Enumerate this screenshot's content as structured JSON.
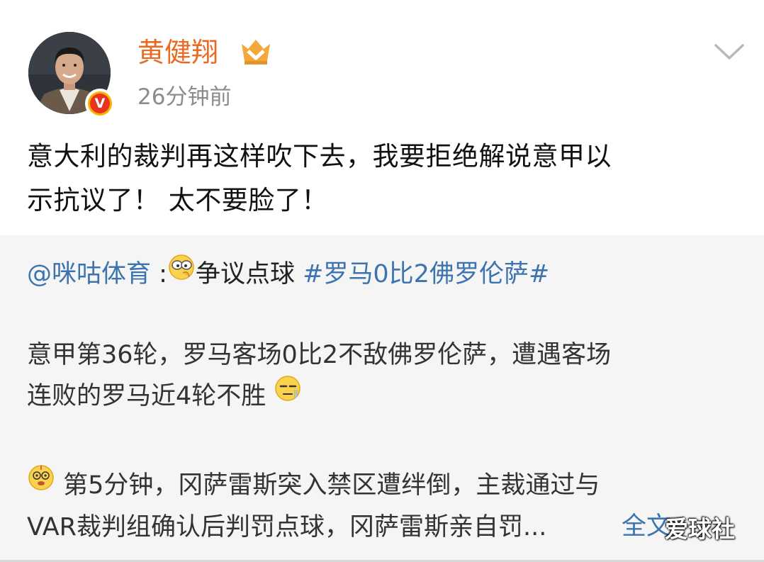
{
  "header": {
    "user_name": "黄健翔",
    "post_time": "26分钟前",
    "verified_badge": "V",
    "member_icon": "vip-crown-icon",
    "more_icon": "chevron-down-icon"
  },
  "post": {
    "lines": [
      "意大利的裁判再这样吹下去，我要拒绝解说意甲以",
      "示抗议了！ 太不要脸了！"
    ]
  },
  "repost": {
    "mention": "@咪咕体育",
    "separator": " :",
    "emoji_1": "sneaky-face-emoji",
    "topic_text": "争议点球 ",
    "hashtag": "#罗马0比2佛罗伦萨#",
    "body_lines": [
      "意甲第36轮，罗马客场0比2不敌佛罗伦萨，遭遇客场",
      "连败的罗马近4轮不胜"
    ],
    "emoji_2": "speechless-face-emoji",
    "emoji_3": "dizzy-face-emoji",
    "body2_lines": [
      " 第5分钟，冈萨雷斯突入禁区遭绊倒，主裁通过与",
      "VAR裁判组确认后判罚点球，冈萨雷斯亲自罚..."
    ],
    "full_text_link": "全文"
  },
  "watermark": "爱球社",
  "colors": {
    "name_orange": "#ea6a21",
    "link_blue": "#3d74b0",
    "repost_bg": "#f5f5f5",
    "time_gray": "#8c8c8c"
  }
}
